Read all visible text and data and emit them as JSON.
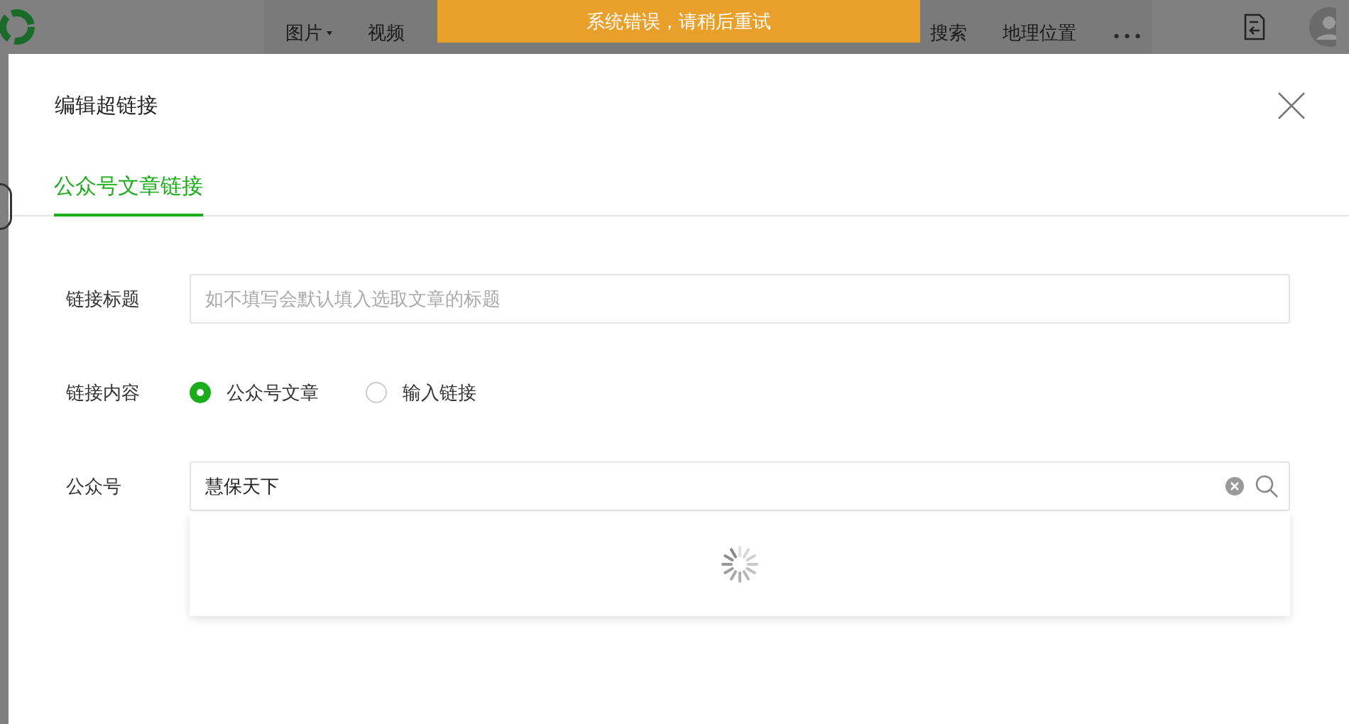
{
  "toolbar": {
    "items": [
      {
        "label": "图片",
        "has_caret": true
      },
      {
        "label": "视频",
        "has_caret": false
      },
      {
        "label": "搜索",
        "has_caret": false
      },
      {
        "label": "地理位置",
        "has_caret": false
      }
    ],
    "more": "•••"
  },
  "toast": {
    "message": "系统错误，请稍后重试"
  },
  "dialog": {
    "title": "编辑超链接",
    "tabs": [
      {
        "label": "公众号文章链接",
        "selected": true
      }
    ],
    "fields": [
      {
        "kind": "text",
        "label": "链接标题",
        "placeholder": "如不填写会默认填入选取文章的标题"
      },
      {
        "kind": "radio",
        "label": "链接内容",
        "options": [
          {
            "label": "公众号文章",
            "selected": true
          },
          {
            "label": "输入链接",
            "selected": false
          }
        ]
      },
      {
        "kind": "search",
        "label": "公众号",
        "value": "慧保天下",
        "loading": true
      }
    ]
  }
}
